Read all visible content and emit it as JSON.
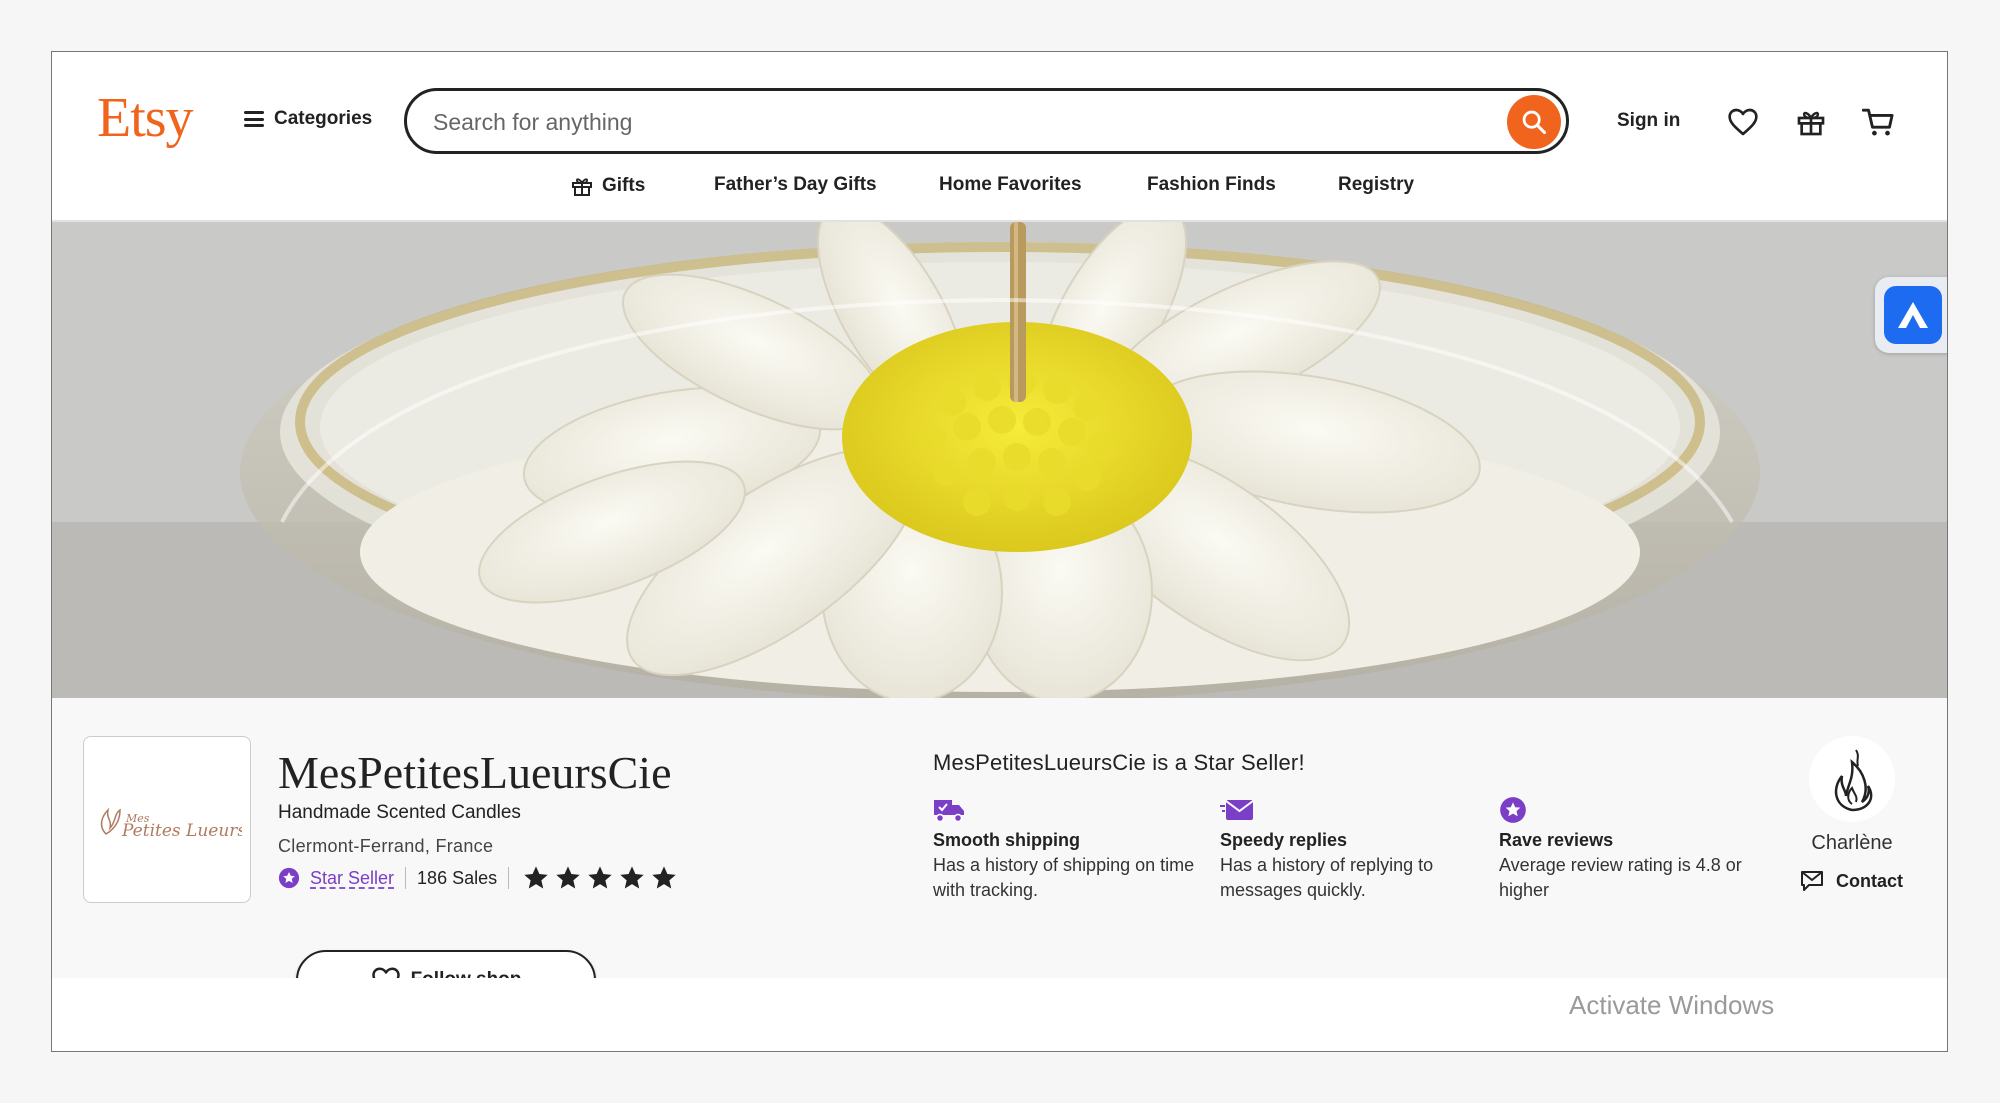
{
  "header": {
    "logo": "Etsy",
    "categories_label": "Categories",
    "search_placeholder": "Search for anything",
    "sign_in_label": "Sign in"
  },
  "subnav": {
    "items": [
      {
        "label": "Gifts",
        "icon": "gift-icon"
      },
      {
        "label": "Father’s Day Gifts"
      },
      {
        "label": "Home Favorites"
      },
      {
        "label": "Fashion Finds"
      },
      {
        "label": "Registry"
      }
    ]
  },
  "shop": {
    "name": "MesPetitesLueursCie",
    "tagline": "Handmade Scented Candles",
    "location": "Clermont-Ferrand, France",
    "star_seller_label": "Star Seller",
    "sales": "186 Sales",
    "rating_stars": 5,
    "follow_label": "Follow shop",
    "logo_text": "Mes Petites Lueurs"
  },
  "star_seller": {
    "title": "MesPetitesLueursCie is a Star Seller!",
    "perks": [
      {
        "title": "Smooth shipping",
        "desc": "Has a history of shipping on time with tracking.",
        "icon": "truck-icon"
      },
      {
        "title": "Speedy replies",
        "desc": "Has a history of replying to messages quickly.",
        "icon": "envelope-icon"
      },
      {
        "title": "Rave reviews",
        "desc": "Average review rating is 4.8 or higher",
        "icon": "star-badge-icon"
      }
    ]
  },
  "owner": {
    "name": "Charlène",
    "contact_label": "Contact"
  },
  "os_watermark": "Activate Windows",
  "colors": {
    "brand": "#f1641e",
    "star_seller": "#7a3ec7",
    "extension": "#1c6bf0"
  }
}
